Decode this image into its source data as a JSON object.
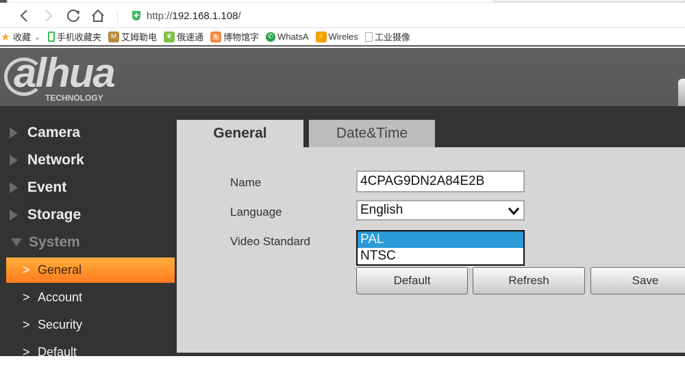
{
  "browser": {
    "url_scheme": "http://",
    "url_host": "192.168.1.108",
    "url_path": "/",
    "bookmarks": [
      {
        "label": "收藏",
        "icon": "star-icon",
        "suffix": "⌄"
      },
      {
        "label": "手机收藏夹",
        "icon": "phone-icon"
      },
      {
        "label": "艾姆勒电",
        "icon": "site-icon"
      },
      {
        "label": "俄速通",
        "icon": "leaf-icon"
      },
      {
        "label": "博物馆字",
        "icon": "site-icon"
      },
      {
        "label": "WhatsA",
        "icon": "whatsapp-icon"
      },
      {
        "label": "Wireles",
        "icon": "site-icon"
      },
      {
        "label": "工业摄像",
        "icon": "page-icon"
      }
    ]
  },
  "brand": {
    "logo_text": "alhua",
    "logo_sub": "TECHNOLOGY"
  },
  "sidebar": {
    "sections": [
      {
        "label": "Camera",
        "expanded": false
      },
      {
        "label": "Network",
        "expanded": false
      },
      {
        "label": "Event",
        "expanded": false
      },
      {
        "label": "Storage",
        "expanded": false
      },
      {
        "label": "System",
        "expanded": true
      }
    ],
    "system_items": [
      {
        "label": "General",
        "active": true
      },
      {
        "label": "Account",
        "active": false
      },
      {
        "label": "Security",
        "active": false
      },
      {
        "label": "Default",
        "active": false
      }
    ]
  },
  "tabs": [
    {
      "label": "General",
      "active": true
    },
    {
      "label": "Date&Time",
      "active": false
    }
  ],
  "form": {
    "name_label": "Name",
    "name_value": "4CPAG9DN2A84E2B",
    "language_label": "Language",
    "language_value": "English",
    "video_label": "Video Standard",
    "video_options": [
      "PAL",
      "NTSC"
    ],
    "video_selected": "PAL"
  },
  "buttons": {
    "default": "Default",
    "refresh": "Refresh",
    "save": "Save"
  },
  "colors": {
    "accent": "#ff8c26",
    "selected_option": "#2b9ad8"
  }
}
